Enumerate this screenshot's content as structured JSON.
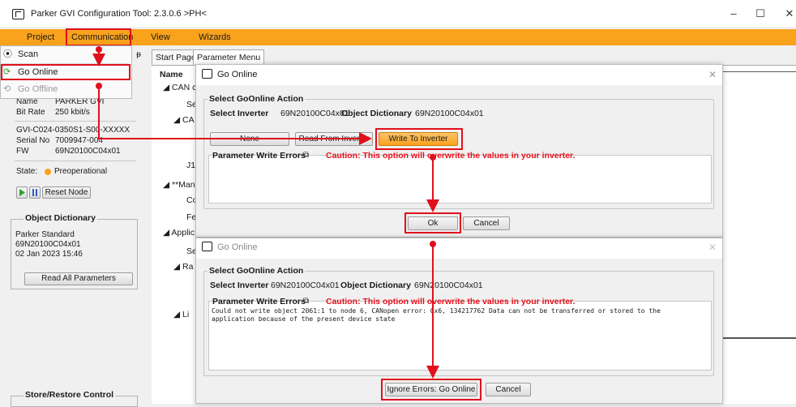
{
  "window": {
    "title": "Parker GVI Configuration Tool: 2.3.0.6  >PH<",
    "minimize": "–",
    "maximize": "☐",
    "close": "✕"
  },
  "menu": [
    "Project",
    "Communication",
    "View",
    "Wizards"
  ],
  "communication_menu": {
    "items": [
      {
        "label": "Scan",
        "icon": "scan-icon"
      },
      {
        "label": "Go Online",
        "icon": "go-online-icon"
      },
      {
        "label": "Go Offline",
        "icon": "go-offline-icon"
      }
    ]
  },
  "device": {
    "name_label": "Name",
    "name_value": "PARKER GVI",
    "bitrate_label": "Bit Rate",
    "bitrate_value": "250 kbit/s",
    "model": "GVI-C024-0350S1-S00-XXXXX",
    "serial_label": "Serial No",
    "serial_value": "7009947-004",
    "fw_label": "FW",
    "fw_value": "69N20100C04x01",
    "state_label": "State:",
    "state_value": "Preoperational",
    "reset_label": "Reset Node"
  },
  "object_dictionary": {
    "title": "Object Dictionary",
    "lines": [
      "Parker Standard",
      "69N20100C04x01",
      "02 Jan 2023 15:46"
    ],
    "read_all_label": "Read All Parameters"
  },
  "store_restore": {
    "title": "Store/Restore Control"
  },
  "pin_glyph": "ᵽ",
  "tabs": [
    "Start Page",
    "Parameter Menu"
  ],
  "tree": {
    "header": "Name",
    "items": [
      "CAN c",
      "Se",
      "CA",
      "J1",
      "**Man",
      "Co",
      "Fe",
      "Applic",
      "Se",
      "Ra",
      "Li"
    ]
  },
  "dialog1": {
    "title": "Go Online",
    "group_title": "Select GoOnline Action",
    "select_inverter_label": "Select Inverter",
    "inverter_value": "69N20100C04x01",
    "object_dictionary_label": "Object Dictionary",
    "od_value": "69N20100C04x01",
    "none_button": "None",
    "read_button": "Read From Inverter",
    "write_button": "Write To Inverter",
    "errors_label": "Parameter Write Errors",
    "caution": "Caution: This option will overwrite the values in your inverter.",
    "ok_button": "Ok",
    "cancel_button": "Cancel"
  },
  "dialog2": {
    "title": "Go Online",
    "group_title": "Select GoOnline Action",
    "select_inverter_label": "Select Inverter",
    "inverter_value": "69N20100C04x01",
    "object_dictionary_label": "Object Dictionary",
    "od_value": "69N20100C04x01",
    "errors_label": "Parameter Write Errors",
    "caution": "Caution: This option will overwrite the values in your inverter.",
    "error_line1": "Could not write object 2061:1  to node 6, CANopen error: 0x6, 134217762 Data can not be transferred or stored to the",
    "error_line2": "application because of the present device state",
    "ignore_button": "Ignore Errors: Go Online",
    "cancel_button": "Cancel"
  },
  "colors": {
    "menubar": "#f9a21b",
    "highlight": "#e0101c",
    "write_button": "#f9a21b",
    "state_dot": "#f9a21b",
    "play": "#2e9e2e",
    "pause": "#2f5fbf"
  }
}
